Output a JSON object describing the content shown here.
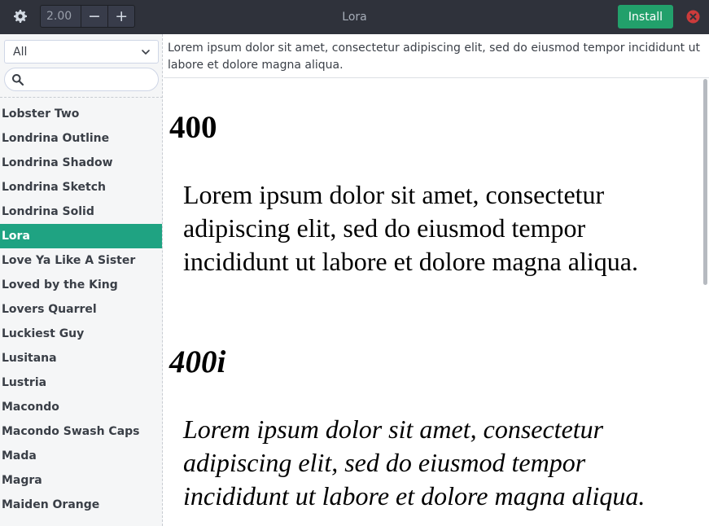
{
  "header": {
    "title": "Lora",
    "size_value": "2.00",
    "decrement_label": "−",
    "increment_label": "+",
    "install_label": "Install",
    "icons": {
      "settings": "gear-icon",
      "close": "close-icon"
    },
    "colors": {
      "install": "#22a06b",
      "close": "#cc3b3b",
      "headerbar": "#2f323b"
    }
  },
  "sidebar": {
    "filter_selected": "All",
    "search_value": "",
    "search_icon": "search-icon",
    "fonts": [
      "Lobster Two",
      "Londrina Outline",
      "Londrina Shadow",
      "Londrina Sketch",
      "Londrina Solid",
      "Lora",
      "Love Ya Like A Sister",
      "Loved by the King",
      "Lovers Quarrel",
      "Luckiest Guy",
      "Lusitana",
      "Lustria",
      "Macondo",
      "Macondo Swash Caps",
      "Mada",
      "Magra",
      "Maiden Orange"
    ],
    "selected_font": "Lora",
    "selected_color": "#1fa382"
  },
  "sample_text": "Lorem ipsum dolor sit amet, consectetur adipiscing elit, sed do eiusmod tempor incididunt ut labore et dolore magna aliqua.",
  "preview": {
    "variants": [
      {
        "heading": "400",
        "text": "Lorem ipsum dolor sit amet, consectetur adipiscing elit, sed do eiusmod tempor incididunt ut labore et dolore magna aliqua."
      },
      {
        "heading": "400i",
        "text": "Lorem ipsum dolor sit amet, consectetur adipiscing elit, sed do eiusmod tempor incididunt ut labore et dolore magna aliqua."
      }
    ]
  }
}
